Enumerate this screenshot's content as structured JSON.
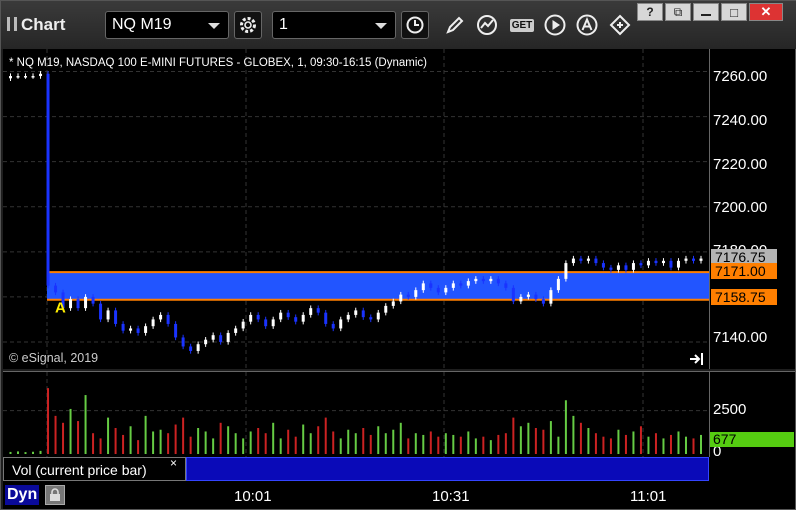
{
  "toolbar": {
    "title": "Chart",
    "symbol_value": "NQ M19",
    "interval_value": "1",
    "get_label": "GET",
    "win_help": "?",
    "win_restore": "⧉",
    "win_max": "□",
    "win_close": "✕"
  },
  "chart": {
    "symbol_line": "* NQ M19, NASDAQ 100 E-MINI FUTURES - GLOBEX, 1, 09:30-16:15 (Dynamic)",
    "copyright": "© eSignal, 2019",
    "marker": "A",
    "price_labels": [
      "7260.00",
      "7240.00",
      "7220.00",
      "7200.00",
      "7180.00",
      "7140.00"
    ],
    "tags": [
      {
        "text": "7176.75",
        "color": "#b4b4b4"
      },
      {
        "text": "7171.00",
        "color": "#ff7f00"
      },
      {
        "text": "7158.75",
        "color": "#ff7f00"
      }
    ],
    "vol_labels": [
      "2500",
      "0"
    ],
    "vol_tag": "677",
    "study_label": "Vol (current price bar)",
    "study_close": "×",
    "dyn_label": "Dyn",
    "time_labels": [
      "10:01",
      "10:31",
      "11:01"
    ],
    "colors": {
      "range_fill": "#2255ff",
      "range_line": "#ff7f00",
      "vol_up": "#66cc44",
      "vol_down": "#cc2222"
    }
  },
  "chart_data": {
    "type": "candlestick",
    "ylim": [
      7128,
      7270
    ],
    "vol_ylim": [
      0,
      4500
    ],
    "range_band": {
      "high": 7171.0,
      "low": 7158.75
    },
    "last_price": 7176.75,
    "closes": [
      7258,
      7258,
      7258,
      7258,
      7259,
      7165,
      7162,
      7155,
      7159,
      7155,
      7160,
      7157,
      7150,
      7154,
      7148,
      7145,
      7146,
      7144,
      7147,
      7150,
      7152,
      7148,
      7142,
      7138,
      7136,
      7139,
      7141,
      7143,
      7140,
      7144,
      7146,
      7149,
      7152,
      7150,
      7147,
      7150,
      7153,
      7151,
      7149,
      7152,
      7155,
      7153,
      7148,
      7146,
      7150,
      7152,
      7154,
      7151,
      7150,
      7153,
      7156,
      7158,
      7161,
      7160,
      7163,
      7166,
      7164,
      7162,
      7164,
      7166,
      7165,
      7167,
      7168,
      7167,
      7168,
      7166,
      7164,
      7158,
      7160,
      7161,
      7159,
      7157,
      7163,
      7168,
      7175,
      7177,
      7176,
      7177,
      7175,
      7173,
      7172,
      7174,
      7172,
      7175,
      7174,
      7176,
      7175,
      7176,
      7173,
      7176,
      7177,
      7176,
      7177
    ],
    "volumes": [
      120,
      150,
      110,
      130,
      180,
      3800,
      2200,
      1800,
      2600,
      1900,
      3400,
      1200,
      900,
      2100,
      1500,
      1100,
      1600,
      800,
      2200,
      1300,
      1400,
      1200,
      1700,
      2100,
      1000,
      1500,
      1300,
      900,
      1800,
      1600,
      1200,
      900,
      1300,
      1500,
      1200,
      1800,
      900,
      1400,
      1000,
      1700,
      1200,
      1600,
      2100,
      1300,
      900,
      1400,
      1200,
      1500,
      1100,
      1600,
      1200,
      1400,
      1800,
      900,
      1200,
      1100,
      1300,
      1000,
      1200,
      1100,
      1000,
      1300,
      900,
      1000,
      800,
      1100,
      1200,
      2100,
      1600,
      1800,
      1500,
      1400,
      1900,
      1000,
      3100,
      2200,
      1800,
      1500,
      1200,
      1000,
      900,
      1400,
      1100,
      1300,
      1600,
      1000,
      1200,
      900,
      1100,
      1300,
      1000,
      900,
      1100
    ]
  }
}
